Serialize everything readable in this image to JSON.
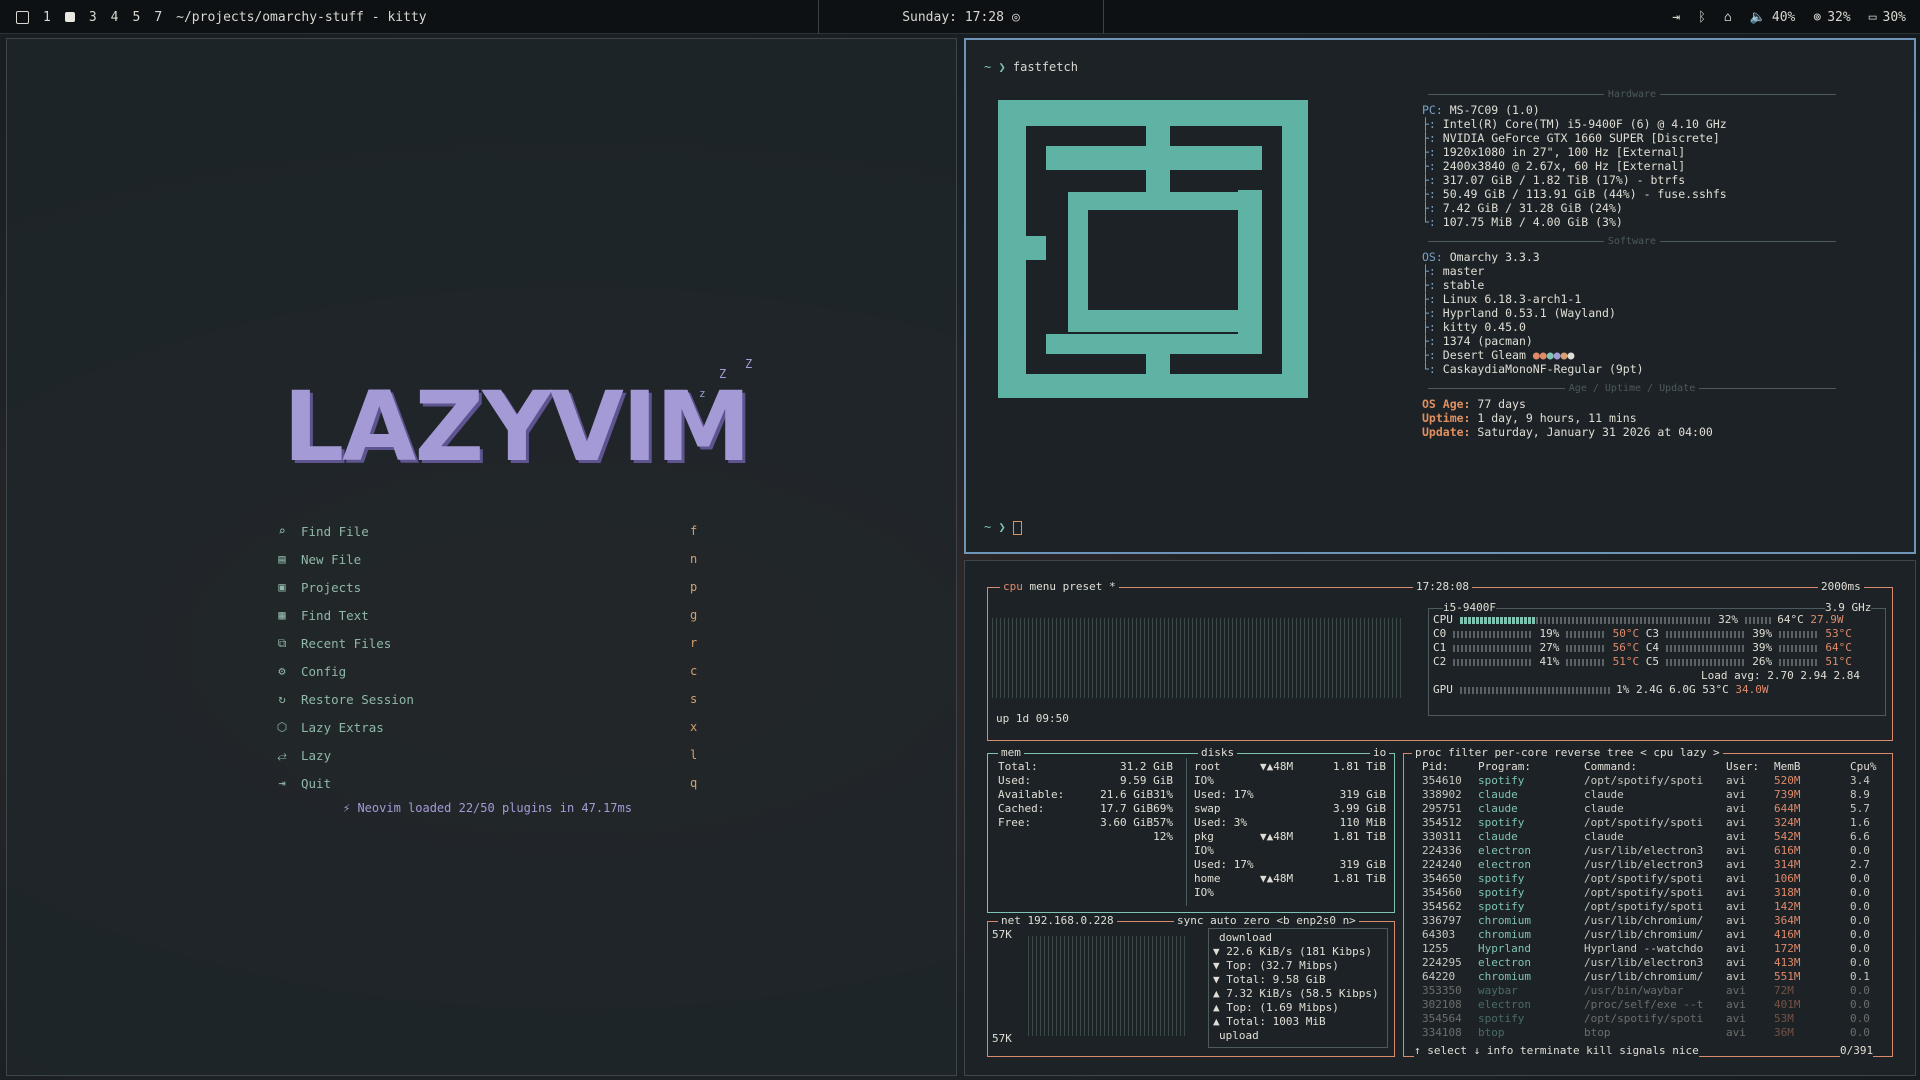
{
  "topbar": {
    "workspaces": [
      "1",
      "3",
      "4",
      "5",
      "7"
    ],
    "window_title": "~/projects/omarchy-stuff - kitty",
    "clock": "Sunday: 17:28",
    "battery_a": "40%",
    "cpu": "32%",
    "battery_b": "30%"
  },
  "nvim": {
    "logo": "LAZYVIM",
    "zz": [
      "z",
      "z",
      "Z",
      "Z"
    ],
    "menu": [
      {
        "icon": "search-icon",
        "label": "Find File",
        "key": "f"
      },
      {
        "icon": "file-icon",
        "label": "New File",
        "key": "n"
      },
      {
        "icon": "projects-icon",
        "label": "Projects",
        "key": "p"
      },
      {
        "icon": "text-icon",
        "label": "Find Text",
        "key": "g"
      },
      {
        "icon": "recent-icon",
        "label": "Recent Files",
        "key": "r"
      },
      {
        "icon": "gear-icon",
        "label": "Config",
        "key": "c"
      },
      {
        "icon": "restore-icon",
        "label": "Restore Session",
        "key": "s"
      },
      {
        "icon": "extras-icon",
        "label": "Lazy Extras",
        "key": "x"
      },
      {
        "icon": "lazy-icon",
        "label": "Lazy",
        "key": "l"
      },
      {
        "icon": "quit-icon",
        "label": "Quit",
        "key": "q"
      }
    ],
    "footer": "⚡ Neovim loaded 22/50 plugins in 47.17ms"
  },
  "fastfetch": {
    "prompt1": "fastfetch",
    "prompt_symbol": "~ ❯",
    "hardware_title": "Hardware",
    "hardware": [
      {
        "k": "PC:",
        "v": "MS-7C09 (1.0)"
      },
      {
        "k": "├:",
        "v": "Intel(R) Core(TM) i5-9400F (6) @ 4.10 GHz"
      },
      {
        "k": "├:",
        "v": "NVIDIA GeForce GTX 1660 SUPER [Discrete]"
      },
      {
        "k": "├:",
        "v": "1920x1080 in 27\", 100 Hz [External]"
      },
      {
        "k": "├:",
        "v": "2400x3840 @ 2.67x, 60 Hz [External]"
      },
      {
        "k": "├:",
        "v": "317.07 GiB / 1.82 TiB (17%) - btrfs"
      },
      {
        "k": "├:",
        "v": "50.49 GiB / 113.91 GiB (44%) - fuse.sshfs"
      },
      {
        "k": "├:",
        "v": "7.42 GiB / 31.28 GiB (24%)"
      },
      {
        "k": "└:",
        "v": "107.75 MiB / 4.00 GiB (3%)"
      }
    ],
    "software_title": "Software",
    "software": [
      {
        "k": "OS:",
        "v": "Omarchy 3.3.3"
      },
      {
        "k": "├:",
        "v": "master"
      },
      {
        "k": "├:",
        "v": "stable"
      },
      {
        "k": "├:",
        "v": "Linux 6.18.3-arch1-1"
      },
      {
        "k": "├:",
        "v": "Hyprland 0.53.1 (Wayland)"
      },
      {
        "k": "├:",
        "v": "kitty 0.45.0"
      },
      {
        "k": "├:",
        "v": "1374 (pacman)"
      },
      {
        "k": "├:",
        "v": "Desert Gleam"
      },
      {
        "k": "└:",
        "v": "CaskaydiaMonoNF-Regular (9pt)"
      }
    ],
    "age_title": "Age / Uptime / Update",
    "age": [
      {
        "k": "OS Age:",
        "v": "77 days"
      },
      {
        "k": "Uptime:",
        "v": "1 day, 9 hours, 11 mins"
      },
      {
        "k": "Update:",
        "v": "Saturday, January 31 2026 at 04:00"
      }
    ]
  },
  "btop": {
    "cpu_tabs": [
      "cpu",
      "menu",
      "preset *"
    ],
    "clock": "17:28:08",
    "interval": "2000ms",
    "cpu_name": "i5-9400F",
    "cpu_freq": "3.9 GHz",
    "cpu_total": {
      "label": "CPU",
      "pct": "32%",
      "temp": "64°C",
      "watts": "27.9W"
    },
    "cores": [
      {
        "a": "C0",
        "ap": "19%",
        "at": "50°C",
        "b": "C3",
        "bp": "39%",
        "bt": "53°C"
      },
      {
        "a": "C1",
        "ap": "27%",
        "at": "56°C",
        "b": "C4",
        "bp": "39%",
        "bt": "64°C"
      },
      {
        "a": "C2",
        "ap": "41%",
        "at": "51°C",
        "b": "C5",
        "bp": "26%",
        "bt": "51°C"
      }
    ],
    "load_avg": "Load avg: 2.70 2.94 2.84",
    "gpu": {
      "label": "GPU",
      "pct": "1%",
      "mem": "2.4G 6.0G",
      "temp": "53°C",
      "watts": "34.0W"
    },
    "uptime": "up 1d 09:50",
    "mem": [
      {
        "k": "Total:",
        "v": "31.2 GiB"
      },
      {
        "k": "Used:",
        "v": "9.59 GiB"
      },
      {
        "k": "",
        "v": "31%"
      },
      {
        "k": "Available:",
        "v": "21.6 GiB"
      },
      {
        "k": "",
        "v": "69%"
      },
      {
        "k": "Cached:",
        "v": "17.7 GiB"
      },
      {
        "k": "",
        "v": "57%"
      },
      {
        "k": "Free:",
        "v": "3.60 GiB"
      },
      {
        "k": "",
        "v": "12%"
      }
    ],
    "disks": [
      {
        "k": "root",
        "m": "▼▲48M",
        "v": "1.81 TiB"
      },
      {
        "k": "IO%",
        "m": "",
        "v": ""
      },
      {
        "k": "Used: 17%",
        "m": "",
        "v": "319 GiB"
      },
      {
        "k": "swap",
        "m": "",
        "v": "3.99 GiB"
      },
      {
        "k": "Used:  3%",
        "m": "",
        "v": "110 MiB"
      },
      {
        "k": "pkg",
        "m": "▼▲48M",
        "v": "1.81 TiB"
      },
      {
        "k": "IO%",
        "m": "",
        "v": ""
      },
      {
        "k": "Used: 17%",
        "m": "",
        "v": "319 GiB"
      },
      {
        "k": "home",
        "m": "▼▲48M",
        "v": "1.81 TiB"
      },
      {
        "k": "IO%",
        "m": "",
        "v": ""
      }
    ],
    "net": {
      "label": "net",
      "ip": "192.168.0.228",
      "tabs": "sync auto zero <b enp2s0 n>",
      "scale": "57K",
      "rows": [
        "download",
        "▼ 22.6 KiB/s  (181 Kibps)",
        "▼ Top:        (32.7 Mibps)",
        "▼ Total:         9.58 GiB",
        "▲ 7.32 KiB/s (58.5 Kibps)",
        "▲ Top:        (1.69 Mibps)",
        "▲ Total:         1003 MiB",
        "upload"
      ]
    },
    "proc": {
      "header": "proc  filter          per-core  reverse  tree  < cpu lazy >",
      "columns": [
        "Pid:",
        "Program:",
        "Command:",
        "User:",
        "MemB",
        "Cpu%"
      ],
      "rows": [
        [
          "354610",
          "spotify",
          "/opt/spotify/spoti",
          "avi",
          "520M",
          "3.4"
        ],
        [
          "338902",
          "claude",
          "claude",
          "avi",
          "739M",
          "8.9"
        ],
        [
          "295751",
          "claude",
          "claude",
          "avi",
          "644M",
          "5.7"
        ],
        [
          "354512",
          "spotify",
          "/opt/spotify/spoti",
          "avi",
          "324M",
          "1.6"
        ],
        [
          "330311",
          "claude",
          "claude",
          "avi",
          "542M",
          "6.6"
        ],
        [
          "224336",
          "electron",
          "/usr/lib/electron3",
          "avi",
          "616M",
          "0.0"
        ],
        [
          "224240",
          "electron",
          "/usr/lib/electron3",
          "avi",
          "314M",
          "2.7"
        ],
        [
          "354650",
          "spotify",
          "/opt/spotify/spoti",
          "avi",
          "106M",
          "0.0"
        ],
        [
          "354560",
          "spotify",
          "/opt/spotify/spoti",
          "avi",
          "318M",
          "0.0"
        ],
        [
          "354562",
          "spotify",
          "/opt/spotify/spoti",
          "avi",
          "142M",
          "0.0"
        ],
        [
          "336797",
          "chromium",
          "/usr/lib/chromium/",
          "avi",
          "364M",
          "0.0"
        ],
        [
          "64303",
          "chromium",
          "/usr/lib/chromium/",
          "avi",
          "416M",
          "0.0"
        ],
        [
          "1255",
          "Hyprland",
          "Hyprland --watchdo",
          "avi",
          "172M",
          "0.0"
        ],
        [
          "224295",
          "electron",
          "/usr/lib/electron3",
          "avi",
          "413M",
          "0.0"
        ],
        [
          "64220",
          "chromium",
          "/usr/lib/chromium/",
          "avi",
          "551M",
          "0.1"
        ],
        [
          "353350",
          "waybar",
          "/usr/bin/waybar",
          "avi",
          "72M",
          "0.0"
        ],
        [
          "302108",
          "electron",
          "/proc/self/exe --t",
          "avi",
          "401M",
          "0.0"
        ],
        [
          "354564",
          "spotify",
          "/opt/spotify/spoti",
          "avi",
          "53M",
          "0.0"
        ],
        [
          "334108",
          "btop",
          "btop",
          "avi",
          "36M",
          "0.0"
        ]
      ],
      "footer": "↑ select ↓   info   terminate   kill   signals   nice",
      "count": "0/391"
    }
  }
}
